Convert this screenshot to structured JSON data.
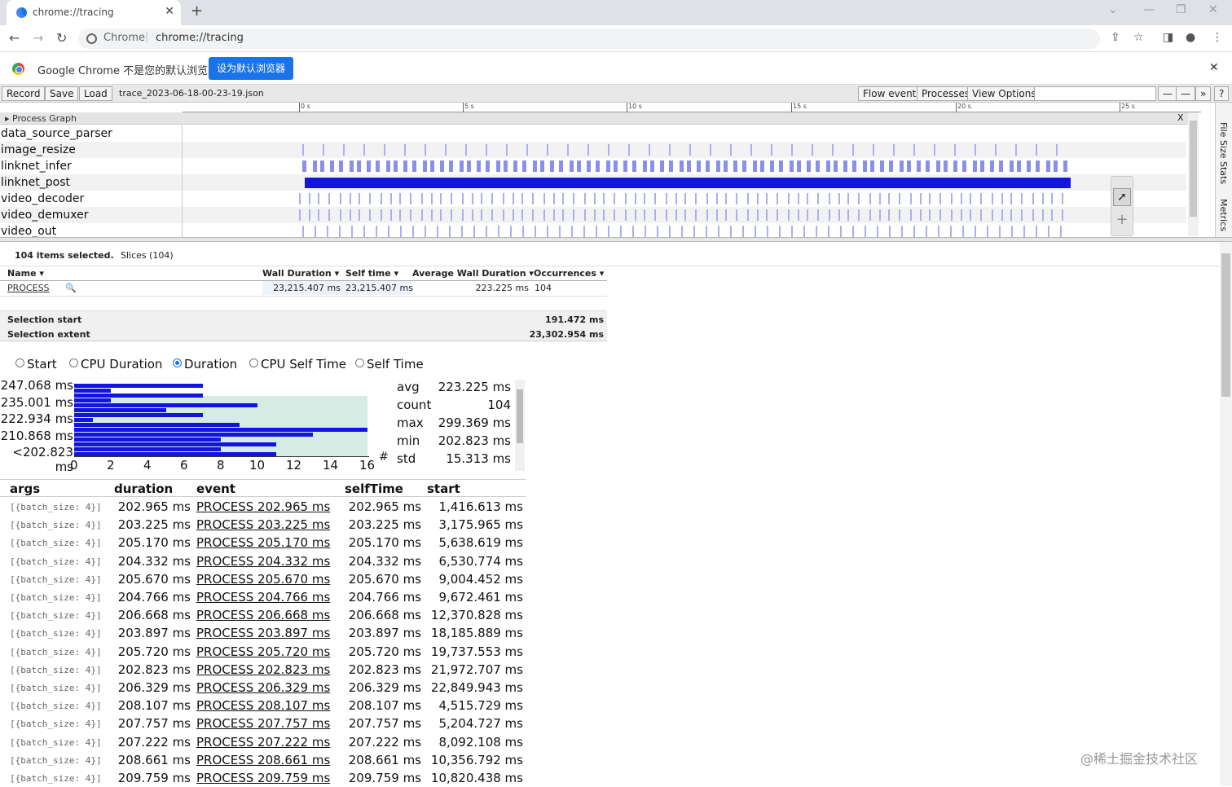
{
  "browser": {
    "tab_title": "chrome://tracing",
    "site_label": "Chrome",
    "url": "chrome://tracing",
    "infobar_message": "Google Chrome 不是您的默认浏览器",
    "infobar_button": "设为默认浏览器"
  },
  "toolbar": {
    "record": "Record",
    "save": "Save",
    "load": "Load",
    "filename": "trace_2023-06-18-00-23-19.json",
    "flow_events": "Flow events",
    "processes": "Processes",
    "view_options": "View Options",
    "zoom_out": "—",
    "zoom_in": "—",
    "more": "»",
    "help": "?"
  },
  "ruler": {
    "ticks": [
      "0 s",
      "5 s",
      "10 s",
      "15 s",
      "20 s",
      "25 s"
    ]
  },
  "process_graph": {
    "header": "Process Graph",
    "close": "X",
    "rows": [
      "data_source_parser",
      "image_resize",
      "linknet_infer",
      "linknet_post",
      "video_decoder",
      "video_demuxer",
      "video_out"
    ]
  },
  "side_tabs": [
    "File Size Stats",
    "Metrics"
  ],
  "selection": {
    "summary": "104 items selected.",
    "tab": "Slices (104)",
    "columns": {
      "name": "Name",
      "wall": "Wall Duration",
      "self": "Self time",
      "avg": "Average Wall Duration",
      "occ": "Occurrences"
    },
    "row": {
      "name": "PROCESS",
      "wall": "23,215.407 ms",
      "self": "23,215.407 ms",
      "avg": "223.225 ms",
      "occ": "104"
    },
    "start_label": "Selection start",
    "start_value": "191.472 ms",
    "extent_label": "Selection extent",
    "extent_value": "23,302.954 ms"
  },
  "radios": {
    "options": [
      "Start",
      "CPU Duration",
      "Duration",
      "CPU Self Time",
      "Self Time"
    ],
    "selected": "Duration"
  },
  "histogram": {
    "y_labels": [
      "247.068 ms",
      "235.001 ms",
      "222.934 ms",
      "210.868 ms",
      "<202.823 ms"
    ],
    "x_labels": [
      "0",
      "2",
      "4",
      "6",
      "8",
      "10",
      "12",
      "14",
      "16"
    ],
    "x_unit": "#",
    "bar_counts": [
      7,
      2,
      7,
      2,
      10,
      5,
      7,
      1,
      9,
      16,
      13,
      8,
      11,
      8,
      11
    ]
  },
  "stats": [
    {
      "k": "avg",
      "v": "223.225 ms"
    },
    {
      "k": "count",
      "v": "104"
    },
    {
      "k": "max",
      "v": "299.369 ms"
    },
    {
      "k": "min",
      "v": "202.823 ms"
    },
    {
      "k": "std",
      "v": "15.313 ms"
    }
  ],
  "list": {
    "columns": [
      "args",
      "duration",
      "event",
      "selfTime",
      "start"
    ],
    "rows": [
      {
        "args": "[{batch_size: 4}]",
        "duration": "202.965 ms",
        "event": "PROCESS 202.965 ms",
        "self": "202.965 ms",
        "start": "1,416.613 ms"
      },
      {
        "args": "[{batch_size: 4}]",
        "duration": "203.225 ms",
        "event": "PROCESS 203.225 ms",
        "self": "203.225 ms",
        "start": "3,175.965 ms"
      },
      {
        "args": "[{batch_size: 4}]",
        "duration": "205.170 ms",
        "event": "PROCESS 205.170 ms",
        "self": "205.170 ms",
        "start": "5,638.619 ms"
      },
      {
        "args": "[{batch_size: 4}]",
        "duration": "204.332 ms",
        "event": "PROCESS 204.332 ms",
        "self": "204.332 ms",
        "start": "6,530.774 ms"
      },
      {
        "args": "[{batch_size: 4}]",
        "duration": "205.670 ms",
        "event": "PROCESS 205.670 ms",
        "self": "205.670 ms",
        "start": "9,004.452 ms"
      },
      {
        "args": "[{batch_size: 4}]",
        "duration": "204.766 ms",
        "event": "PROCESS 204.766 ms",
        "self": "204.766 ms",
        "start": "9,672.461 ms"
      },
      {
        "args": "[{batch_size: 4}]",
        "duration": "206.668 ms",
        "event": "PROCESS 206.668 ms",
        "self": "206.668 ms",
        "start": "12,370.828 ms"
      },
      {
        "args": "[{batch_size: 4}]",
        "duration": "203.897 ms",
        "event": "PROCESS 203.897 ms",
        "self": "203.897 ms",
        "start": "18,185.889 ms"
      },
      {
        "args": "[{batch_size: 4}]",
        "duration": "205.720 ms",
        "event": "PROCESS 205.720 ms",
        "self": "205.720 ms",
        "start": "19,737.553 ms"
      },
      {
        "args": "[{batch_size: 4}]",
        "duration": "202.823 ms",
        "event": "PROCESS 202.823 ms",
        "self": "202.823 ms",
        "start": "21,972.707 ms"
      },
      {
        "args": "[{batch_size: 4}]",
        "duration": "206.329 ms",
        "event": "PROCESS 206.329 ms",
        "self": "206.329 ms",
        "start": "22,849.943 ms"
      },
      {
        "args": "[{batch_size: 4}]",
        "duration": "208.107 ms",
        "event": "PROCESS 208.107 ms",
        "self": "208.107 ms",
        "start": "4,515.729 ms"
      },
      {
        "args": "[{batch_size: 4}]",
        "duration": "207.757 ms",
        "event": "PROCESS 207.757 ms",
        "self": "207.757 ms",
        "start": "5,204.727 ms"
      },
      {
        "args": "[{batch_size: 4}]",
        "duration": "207.222 ms",
        "event": "PROCESS 207.222 ms",
        "self": "207.222 ms",
        "start": "8,092.108 ms"
      },
      {
        "args": "[{batch_size: 4}]",
        "duration": "208.661 ms",
        "event": "PROCESS 208.661 ms",
        "self": "208.661 ms",
        "start": "10,356.792 ms"
      },
      {
        "args": "[{batch_size: 4}]",
        "duration": "209.759 ms",
        "event": "PROCESS 209.759 ms",
        "self": "209.759 ms",
        "start": "10,820.438 ms"
      }
    ]
  },
  "watermark": "@稀土掘金技术社区",
  "colors": {
    "slice_dark": "#1414e0",
    "slice_light": "#aab0ee",
    "hist_bg": "#d4ece4",
    "accent": "#1a73e8"
  }
}
